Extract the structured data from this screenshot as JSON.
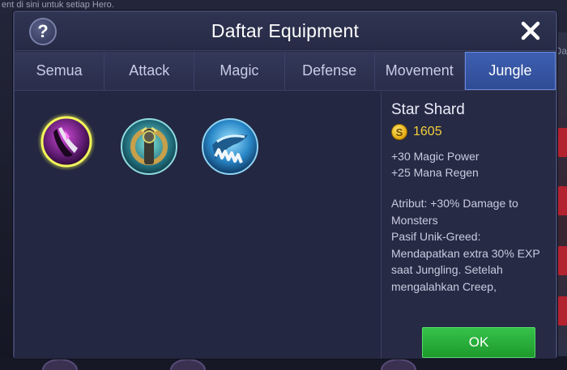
{
  "background": {
    "hint_text": "ent di sini untuk setiap Hero.",
    "right_edge_text": "Da"
  },
  "dialog": {
    "title": "Daftar Equipment",
    "help_label": "?",
    "close_label": "close"
  },
  "tabs": [
    {
      "label": "Semua",
      "active": false
    },
    {
      "label": "Attack",
      "active": false
    },
    {
      "label": "Magic",
      "active": false
    },
    {
      "label": "Defense",
      "active": false
    },
    {
      "label": "Movement",
      "active": false
    },
    {
      "label": "Jungle",
      "active": true
    }
  ],
  "items": [
    {
      "icon": "star-shard-icon",
      "selected": true
    },
    {
      "icon": "ice-retribution-icon",
      "selected": false
    },
    {
      "icon": "flame-retribution-icon",
      "selected": false
    }
  ],
  "detail": {
    "name": "Star Shard",
    "currency_symbol": "S",
    "price": "1605",
    "stats": [
      "+30 Magic Power",
      "+25 Mana Regen"
    ],
    "description": "Atribut: +30% Damage to Monsters\nPasif Unik-Greed: Mendapatkan extra 30% EXP saat Jungling. Setelah mengalahkan Creep, memulihkan HP sebesar"
  },
  "ok_label": "OK",
  "colors": {
    "accent_tab": "#3e5fb0",
    "price": "#f3cf3b",
    "ok_button": "#1d9a2c",
    "selection_glow": "#e8ef3a"
  }
}
